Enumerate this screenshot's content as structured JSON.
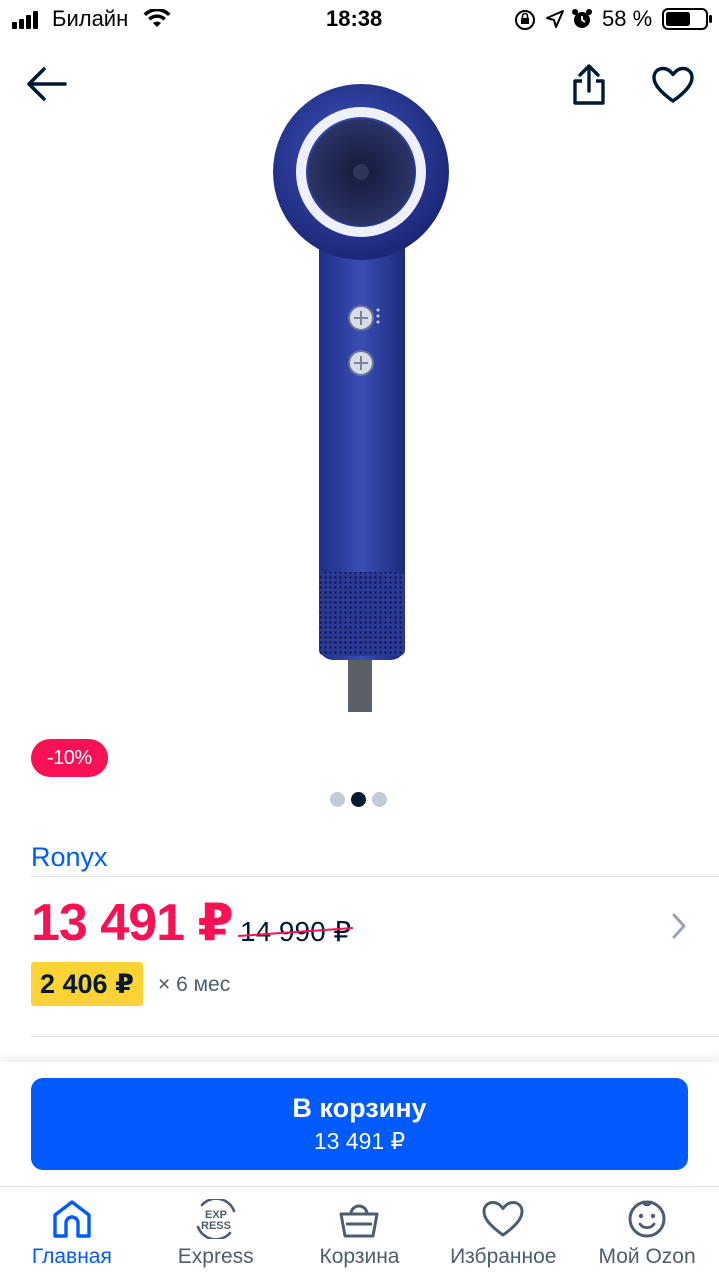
{
  "status_bar": {
    "carrier": "Билайн",
    "time": "18:38",
    "battery": "58 %"
  },
  "header": {
    "back_icon": "arrow-left-icon",
    "share_icon": "share-icon",
    "favorite_icon": "heart-outline-icon"
  },
  "gallery": {
    "discount_badge": "-10%",
    "page_count": 3,
    "active_page": 2
  },
  "product": {
    "brand": "Ronyx",
    "price": "13 491 ₽",
    "old_price": "14 990 ₽",
    "installment_amount": "2 406 ₽",
    "installment_term": "× 6 мес"
  },
  "cart_button": {
    "label": "В корзину",
    "price": "13 491 ₽"
  },
  "tab_bar": {
    "items": [
      {
        "label": "Главная",
        "icon": "home-icon",
        "active": true
      },
      {
        "label": "Express",
        "icon": "express-icon",
        "active": false
      },
      {
        "label": "Корзина",
        "icon": "basket-icon",
        "active": false
      },
      {
        "label": "Избранное",
        "icon": "heart-icon",
        "active": false
      },
      {
        "label": "Мой Ozon",
        "icon": "smiley-icon",
        "active": false
      }
    ]
  },
  "colors": {
    "accent": "#005bff",
    "price": "#f91155",
    "installment": "#ffd336",
    "text": "#001a34"
  }
}
